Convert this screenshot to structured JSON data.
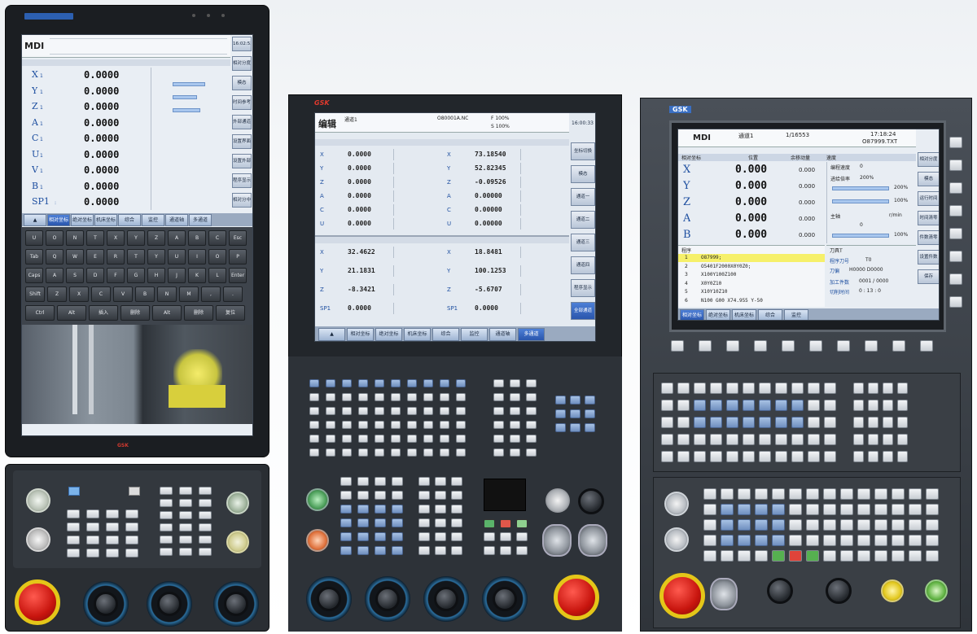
{
  "left_unit": {
    "mode": "MDI",
    "axes": [
      {
        "name": "X",
        "sub": "1",
        "value": "0.0000"
      },
      {
        "name": "Y",
        "sub": "1",
        "value": "0.0000"
      },
      {
        "name": "Z",
        "sub": "1",
        "value": "0.0000"
      },
      {
        "name": "A",
        "sub": "1",
        "value": "0.0000"
      },
      {
        "name": "C",
        "sub": "1",
        "value": "0.0000"
      },
      {
        "name": "U",
        "sub": "1",
        "value": "0.0000"
      },
      {
        "name": "V",
        "sub": "1",
        "value": "0.0000"
      },
      {
        "name": "B",
        "sub": "1",
        "value": "0.0000"
      },
      {
        "name": "SP1",
        "sub": ":",
        "value": "0.0000"
      }
    ],
    "tabs": [
      "▲",
      "相对坐标",
      "绝对坐标",
      "机床坐标",
      "综合",
      "监控",
      "通道轴",
      "多通道"
    ],
    "side_buttons": [
      "16:02:53",
      "相对分度",
      "模态",
      "时间参考",
      "外部通道",
      "设置界面",
      "设置外部",
      "程序显示",
      "相对分中"
    ],
    "keys_row_top": [
      "U",
      "O",
      "N",
      "T",
      "X",
      "Y",
      "Z",
      "A",
      "B",
      "C",
      "Esc"
    ],
    "keys_row1": [
      "Tab",
      "Q",
      "W",
      "E",
      "R",
      "T",
      "Y",
      "U",
      "I",
      "O",
      "P"
    ],
    "keys_row2": [
      "Caps",
      "A",
      "S",
      "D",
      "F",
      "G",
      "H",
      "J",
      "K",
      "L",
      "Enter"
    ],
    "keys_row3": [
      "Shift",
      "Z",
      "X",
      "C",
      "V",
      "B",
      "N",
      "M",
      ",",
      "."
    ],
    "keys_row4": [
      "Ctrl",
      "Alt",
      "插入",
      "删除",
      "Alt",
      "删除",
      "复位"
    ],
    "brand": "GSK"
  },
  "middle_unit": {
    "brand": "GSK",
    "mode": "编辑",
    "info": "通道1",
    "prog": "O80001A.NC",
    "feed": "F 100%",
    "spindle": "S 100%",
    "clock": "16:00:33",
    "upper_left_axes": [
      {
        "name": "X",
        "value": "0.0000"
      },
      {
        "name": "Y",
        "value": "0.0000"
      },
      {
        "name": "Z",
        "value": "0.0000"
      },
      {
        "name": "A",
        "value": "0.0000"
      },
      {
        "name": "C",
        "value": "0.0000"
      },
      {
        "name": "U",
        "value": "0.0000"
      }
    ],
    "upper_right_axes": [
      {
        "name": "X",
        "value": "73.18540"
      },
      {
        "name": "Y",
        "value": "52.82345"
      },
      {
        "name": "Z",
        "value": "-0.09526"
      },
      {
        "name": "A",
        "value": "0.00000"
      },
      {
        "name": "C",
        "value": "0.00000"
      },
      {
        "name": "U",
        "value": "0.00000"
      }
    ],
    "lower_left_axes": [
      {
        "name": "X",
        "value": "32.4622"
      },
      {
        "name": "Y",
        "value": "21.1831"
      },
      {
        "name": "Z",
        "value": "-8.3421"
      },
      {
        "name": "SP1",
        "value": "0.0000"
      }
    ],
    "lower_right_axes": [
      {
        "name": "X",
        "value": "18.8481"
      },
      {
        "name": "Y",
        "value": "100.1253"
      },
      {
        "name": "Z",
        "value": "-5.6707"
      },
      {
        "name": "SP1",
        "value": "0.0000"
      }
    ],
    "side_buttons": [
      "坐标切换",
      "模态",
      "通道一",
      "通道二",
      "通道三",
      "通道四",
      "程序显示",
      "全部通道"
    ],
    "tabs": [
      "▲",
      "相对坐标",
      "绝对坐标",
      "机床坐标",
      "综合",
      "监控",
      "通道轴",
      "多通道"
    ]
  },
  "right_unit": {
    "brand": "GSK",
    "mode": "MDI",
    "channel": "通道1",
    "block": "1/16553",
    "time": "17:18:24",
    "file": "O87999.TXT",
    "col_headers": [
      "相对坐标",
      "位置",
      "余移动量",
      "速度"
    ],
    "axes": [
      {
        "name": "X",
        "value": "0.000",
        "remain": "0.000"
      },
      {
        "name": "Y",
        "value": "0.000",
        "remain": "0.000"
      },
      {
        "name": "Z",
        "value": "0.000",
        "remain": "0.000"
      },
      {
        "name": "A",
        "value": "0.000",
        "remain": "0.000"
      },
      {
        "name": "B",
        "value": "0.000",
        "remain": "0.000"
      }
    ],
    "feed_label": "编程速度",
    "feed_val": "0",
    "override_label": "进给倍率",
    "override_val": "200%",
    "bar1": "200%",
    "bar2": "100%",
    "spindle_label": "主轴",
    "spindle_unit": "r/min",
    "spindle_val": "0",
    "spindle_bar": "100%",
    "program_title": "程序",
    "program_lines": [
      {
        "n": "1",
        "code": "O87999;"
      },
      {
        "n": "2",
        "code": "O5401F2000X0Y0Z0;"
      },
      {
        "n": "3",
        "code": "X100Y100Z100"
      },
      {
        "n": "4",
        "code": "X0Y0Z10"
      },
      {
        "name": "",
        "n": "5",
        "code": "X10Y10Z10"
      },
      {
        "n": "6",
        "code": "N100 G00 X74.955 Y-50"
      }
    ],
    "tool_title": "刀具T",
    "tool_label": "程序刀号",
    "tool_val": "T0",
    "tool2_label": "刀偏",
    "tool2_val": "H0000 D0000",
    "count_label": "加工件数",
    "count_val": "0001 / 0000",
    "cut_label": "切削时间",
    "cut_val": "0 : 13 : 0",
    "tabs": [
      "相对坐标",
      "绝对坐标",
      "机床坐标",
      "综合",
      "监控"
    ],
    "side_buttons": [
      "相对分度",
      "模态",
      "运行时间",
      "时间清零",
      "件数清零",
      "设置件数",
      "保存"
    ]
  }
}
